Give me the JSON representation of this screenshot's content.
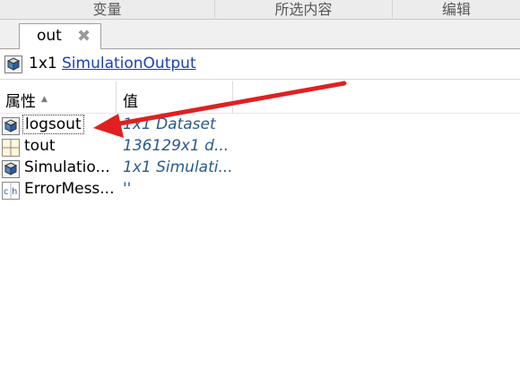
{
  "sections": [
    {
      "label": "变量"
    },
    {
      "label": "所选内容"
    },
    {
      "label": "编辑"
    }
  ],
  "tab": {
    "label": "out",
    "close_glyph": "✖"
  },
  "title": {
    "dimension": "1x1",
    "class_name": "SimulationOutput"
  },
  "columns": {
    "property": "属性",
    "sort_glyph": "▲",
    "value": "值"
  },
  "rows": [
    {
      "name": "logsout",
      "value": "1x1 Dataset",
      "icon": "object-icon"
    },
    {
      "name": "tout",
      "value": "136129x1 d...",
      "icon": "matrix-icon"
    },
    {
      "name": "Simulatio...",
      "value": "1x1 Simulati...",
      "icon": "object-icon"
    },
    {
      "name": "ErrorMess...",
      "value": "''",
      "icon": "char-icon"
    }
  ],
  "colors": {
    "link": "#1a3fc0",
    "value_text": "#2a5a8a",
    "arrow": "#e02020"
  }
}
